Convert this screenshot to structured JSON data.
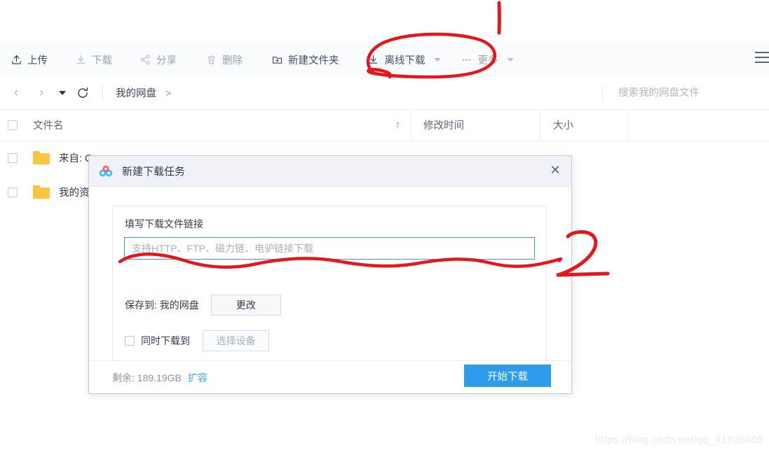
{
  "toolbar": {
    "items": [
      {
        "label": "上传",
        "icon": "upload-icon",
        "state": "active"
      },
      {
        "label": "下载",
        "icon": "download-icon",
        "state": "dim"
      },
      {
        "label": "分享",
        "icon": "share-icon",
        "state": "dim"
      },
      {
        "label": "删除",
        "icon": "trash-icon",
        "state": "dim"
      },
      {
        "label": "新建文件夹",
        "icon": "new-folder-icon",
        "state": "active"
      },
      {
        "label": "离线下载",
        "icon": "offline-download-icon",
        "state": "active"
      },
      {
        "label": "更多",
        "icon": "more-icon",
        "state": "dim"
      }
    ],
    "menu_icon": "hamburger-icon"
  },
  "nav": {
    "back_icon": "chevron-left-icon",
    "forward_icon": "chevron-right-icon",
    "history_caret_icon": "caret-down-icon",
    "refresh_icon": "refresh-icon",
    "breadcrumb": "我的网盘",
    "breadcrumb_sep": ">"
  },
  "search": {
    "placeholder": "搜索我的网盘文件",
    "value": ""
  },
  "table": {
    "columns": {
      "name": "文件名",
      "modified": "修改时间",
      "size": "大小",
      "extra": ""
    },
    "sort_arrow": "↑",
    "rows": [
      {
        "name": "来自: Q",
        "type": "folder",
        "modified": "",
        "size": ""
      },
      {
        "name": "我的资源",
        "type": "folder",
        "modified": "",
        "size": ""
      }
    ]
  },
  "dialog": {
    "title": "新建下载任务",
    "logo_icon": "xunlei-cloud-icon",
    "close_icon": "close-icon",
    "field_label": "填写下载文件链接",
    "url_placeholder": "支持HTTP、FTP、磁力链、电驴链接下载",
    "url_value": "",
    "saveto_label": "保存到: 我的网盘",
    "change_button": "更改",
    "device_checkbox_label": "同时下载到",
    "device_button": "选择设备",
    "quota_text": "剩余: 189.19GB",
    "quota_link": "扩容",
    "submit_button": "开始下载"
  },
  "annotations": {
    "mark_one": "1",
    "mark_two": "2",
    "color": "#e8151a"
  },
  "watermark": "https://blog.csdn.net/qq_41926609",
  "colors": {
    "accent": "#2c9ceb",
    "folder": "#fbc53f",
    "toolbar_bg": "#fafbfc",
    "dialog_head": "#f0f2f7"
  }
}
